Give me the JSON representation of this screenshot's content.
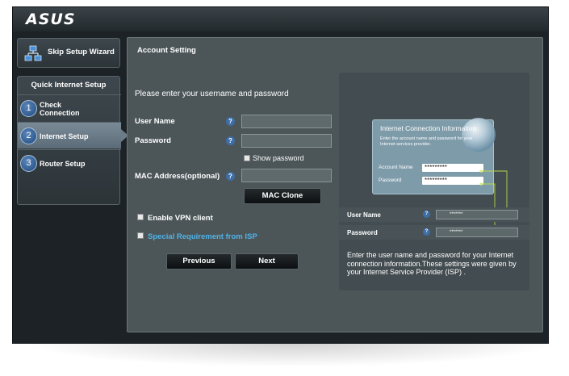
{
  "header": {
    "logo": "ASUS"
  },
  "sidebar": {
    "wizard_label": "Skip Setup Wizard",
    "qis_title": "Quick Internet Setup",
    "steps": [
      {
        "number": "1",
        "label_line1": "Check",
        "label_line2": "Connection"
      },
      {
        "number": "2",
        "label_line1": "Internet Setup",
        "label_line2": ""
      },
      {
        "number": "3",
        "label_line1": "Router Setup",
        "label_line2": ""
      }
    ]
  },
  "main": {
    "title": "Account Setting",
    "prompt": "Please enter your username and password",
    "fields": {
      "username_label": "User Name",
      "password_label": "Password",
      "show_password_label": "Show password",
      "mac_label": "MAC Address(optional)",
      "help_glyph": "?"
    },
    "mac_clone_label": "MAC Clone",
    "vpn_label": "Enable VPN client",
    "isp_label": "Special Requirement from ISP",
    "previous_label": "Previous",
    "next_label": "Next"
  },
  "info_panel": {
    "card_title": "Internet Connection Information",
    "card_desc": "Enter the account name and password for your Internet services provider.",
    "card_account_label": "Account Name",
    "card_password_label": "Password",
    "card_account_value": "*********",
    "card_password_value": "*********",
    "row_username_label": "User Name",
    "row_password_label": "Password",
    "row_value": "*******",
    "help_glyph": "?",
    "text": "Enter the user name and password for your Internet connection information.These settings were given by your Internet Service Provider (ISP) ."
  },
  "colors": {
    "accent_link": "#4fb3e8",
    "panel_bg": "#4c5659",
    "frame_bg": "#1c2226",
    "connector": "#b8d84a"
  },
  "icons": [
    "network-icon",
    "help-icon",
    "globe-icon",
    "checkbox-icon"
  ]
}
